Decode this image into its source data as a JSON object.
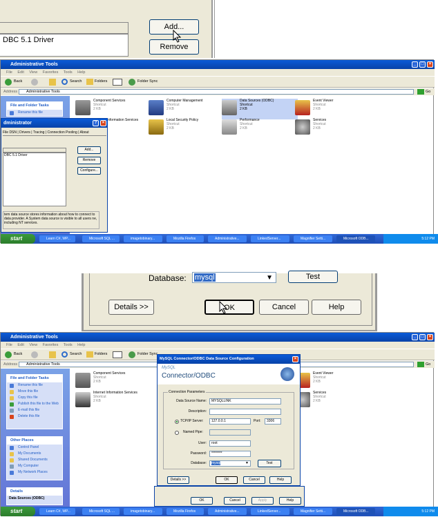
{
  "zoom1": {
    "driver_text": "DBC 5.1 Driver",
    "add_label": "Add...",
    "remove_label": "Remove"
  },
  "explorer": {
    "title": "Administrative Tools",
    "menu": "File  Edit  View  Favorites  Tools  Help",
    "back_label": "Back",
    "search_label": "Search",
    "folders_label": "Folders",
    "foldersync_label": "Folder Sync",
    "address_label": "Address",
    "address_value": "Administrative Tools",
    "go_label": "Go",
    "file_folder_tasks": "File and Folder Tasks",
    "rename": "Rename this file",
    "move": "Move this file",
    "copy": "Copy this file",
    "publish": "Publish this file to the Web",
    "email": "E-mail this file",
    "delete": "Delete this file",
    "other_places": "Other Places",
    "control_panel": "Control Panel",
    "my_documents": "My Documents",
    "shared_documents": "Shared Documents",
    "my_computer": "My Computer",
    "my_network": "My Network Places",
    "details": "Details",
    "details_item": "Data Sources (ODBC)",
    "shortcut": "Shortcut",
    "size": "2 KB",
    "items": {
      "component_services": "Component Services",
      "computer_management": "Computer Management",
      "data_sources": "Data Sources (ODBC)",
      "event_viewer": "Event Viewer",
      "iis": "Internet Information Services",
      "iis_short": "nformation Services",
      "local_security": "Local Security Policy",
      "performance": "Performance",
      "services": "Services"
    }
  },
  "odbc": {
    "title": "dministrator",
    "tabs": "File DSN | Drivers | Tracing | Connection Pooling | About",
    "driver_item": "DBC 5.1 Driver",
    "add": "Add...",
    "remove": "Remove",
    "configure": "Configure...",
    "info": "tem data source stores information about how to connect to data provider.  A System data source is visible to all users ne, including NT services."
  },
  "taskbar": {
    "start": "start",
    "tasks": [
      "Learn C#, WP...",
      "Microsoft SQL ...",
      "imagetobinary...",
      "Mozilla Firefox",
      "Administrative...",
      "LinkedServer...",
      "Magnifier Setti...",
      "Microsoft ODB..."
    ],
    "time": "5:12 PM"
  },
  "zoom2": {
    "database_label": "Database:",
    "database_value": "mysql",
    "test_label": "Test",
    "details_label": "Details >>",
    "ok_label": "OK",
    "cancel_label": "Cancel",
    "help_label": "Help"
  },
  "mysql": {
    "title": "MySQL Connector/ODBC Data Source Configuration",
    "brand_top": "MySQL",
    "brand": "Connector/ODBC",
    "params": "Connection Parameters",
    "dsn_label": "Data Source Name:",
    "dsn_value": "MYSQLLINK",
    "desc_label": "Description:",
    "desc_value": "",
    "tcp_label": "TCP/IP Server:",
    "tcp_value": "127.0.0.1",
    "port_label": "Port:",
    "port_value": "3306",
    "pipe_label": "Named Pipe:",
    "pipe_value": "",
    "user_label": "User:",
    "user_value": "root",
    "pw_label": "Password:",
    "pw_value": "********",
    "db_label": "Database:",
    "db_value": "mysql",
    "test": "Test",
    "details": "Details >>",
    "ok": "OK",
    "cancel": "Cancel",
    "help": "Help",
    "outer_ok": "OK",
    "outer_cancel": "Cancel",
    "outer_apply": "Apply",
    "outer_help": "Help"
  }
}
